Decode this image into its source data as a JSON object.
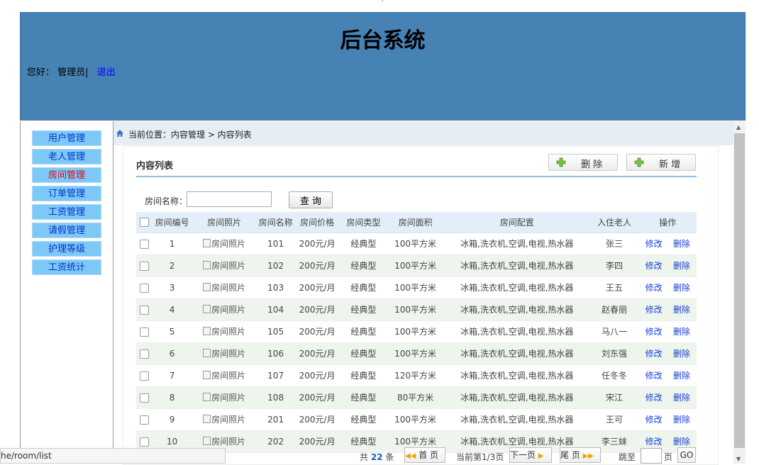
{
  "header": {
    "title": "后台系统",
    "greeting": "您好：",
    "user": "管理员|",
    "logout": "退出"
  },
  "sidebar": {
    "items": [
      {
        "label": "用户管理",
        "active": false
      },
      {
        "label": "老人管理",
        "active": false
      },
      {
        "label": "房间管理",
        "active": true
      },
      {
        "label": "订单管理",
        "active": false
      },
      {
        "label": "工资管理",
        "active": false
      },
      {
        "label": "请假管理",
        "active": false
      },
      {
        "label": "护理等级",
        "active": false
      },
      {
        "label": "工资统计",
        "active": false
      }
    ]
  },
  "breadcrumb": "当前位置：内容管理 > 内容列表",
  "panel": {
    "title": "内容列表",
    "delete_label": "删 除",
    "add_label": "新 增"
  },
  "search": {
    "label": "房间名称：",
    "value": "",
    "button": "查 询"
  },
  "table": {
    "headers": [
      "房间编号",
      "房间照片",
      "房间名称",
      "房间价格",
      "房间类型",
      "房间面积",
      "房间配置",
      "入住老人",
      "操作"
    ],
    "edit_label": "修改",
    "delete_label": "删除",
    "rows": [
      {
        "no": "1",
        "photo": "房间照片",
        "name": "101",
        "price": "200元/月",
        "type": "经典型",
        "area": "100平方米",
        "config": "冰箱,洗衣机,空调,电视,热水器",
        "elder": "张三"
      },
      {
        "no": "2",
        "photo": "房间照片",
        "name": "102",
        "price": "200元/月",
        "type": "经典型",
        "area": "100平方米",
        "config": "冰箱,洗衣机,空调,电视,热水器",
        "elder": "李四"
      },
      {
        "no": "3",
        "photo": "房间照片",
        "name": "103",
        "price": "200元/月",
        "type": "经典型",
        "area": "100平方米",
        "config": "冰箱,洗衣机,空调,电视,热水器",
        "elder": "王五"
      },
      {
        "no": "4",
        "photo": "房间照片",
        "name": "104",
        "price": "200元/月",
        "type": "经典型",
        "area": "100平方米",
        "config": "冰箱,洗衣机,空调,电视,热水器",
        "elder": "赵春丽"
      },
      {
        "no": "5",
        "photo": "房间照片",
        "name": "105",
        "price": "200元/月",
        "type": "经典型",
        "area": "100平方米",
        "config": "冰箱,洗衣机,空调,电视,热水器",
        "elder": "马八一"
      },
      {
        "no": "6",
        "photo": "房间照片",
        "name": "106",
        "price": "200元/月",
        "type": "经典型",
        "area": "100平方米",
        "config": "冰箱,洗衣机,空调,电视,热水器",
        "elder": "刘东强"
      },
      {
        "no": "7",
        "photo": "房间照片",
        "name": "107",
        "price": "200元/月",
        "type": "经典型",
        "area": "120平方米",
        "config": "冰箱,洗衣机,空调,电视,热水器",
        "elder": "任冬冬"
      },
      {
        "no": "8",
        "photo": "房间照片",
        "name": "108",
        "price": "200元/月",
        "type": "经典型",
        "area": "80平方米",
        "config": "冰箱,洗衣机,空调,电视,热水器",
        "elder": "宋江"
      },
      {
        "no": "9",
        "photo": "房间照片",
        "name": "201",
        "price": "200元/月",
        "type": "经典型",
        "area": "100平方米",
        "config": "冰箱,洗衣机,空调,电视,热水器",
        "elder": "王可"
      },
      {
        "no": "10",
        "photo": "房间照片",
        "name": "202",
        "price": "200元/月",
        "type": "经典型",
        "area": "100平方米",
        "config": "冰箱,洗衣机,空调,电视,热水器",
        "elder": "李三妹"
      }
    ]
  },
  "pager": {
    "total_prefix": "共",
    "total": "22",
    "total_suffix": "条",
    "first": "首 页",
    "current": "当前第1/3页",
    "next": "下一页",
    "last": "尾 页",
    "jump_prefix": "跳至",
    "jump_suffix": "页",
    "go": "GO"
  },
  "status_url": "he/room/list",
  "colors": {
    "header_bg": "#4682b4",
    "menu_bg": "#7ec8f7",
    "menu_active_text": "#e0001a",
    "link": "#1a3fd6"
  }
}
